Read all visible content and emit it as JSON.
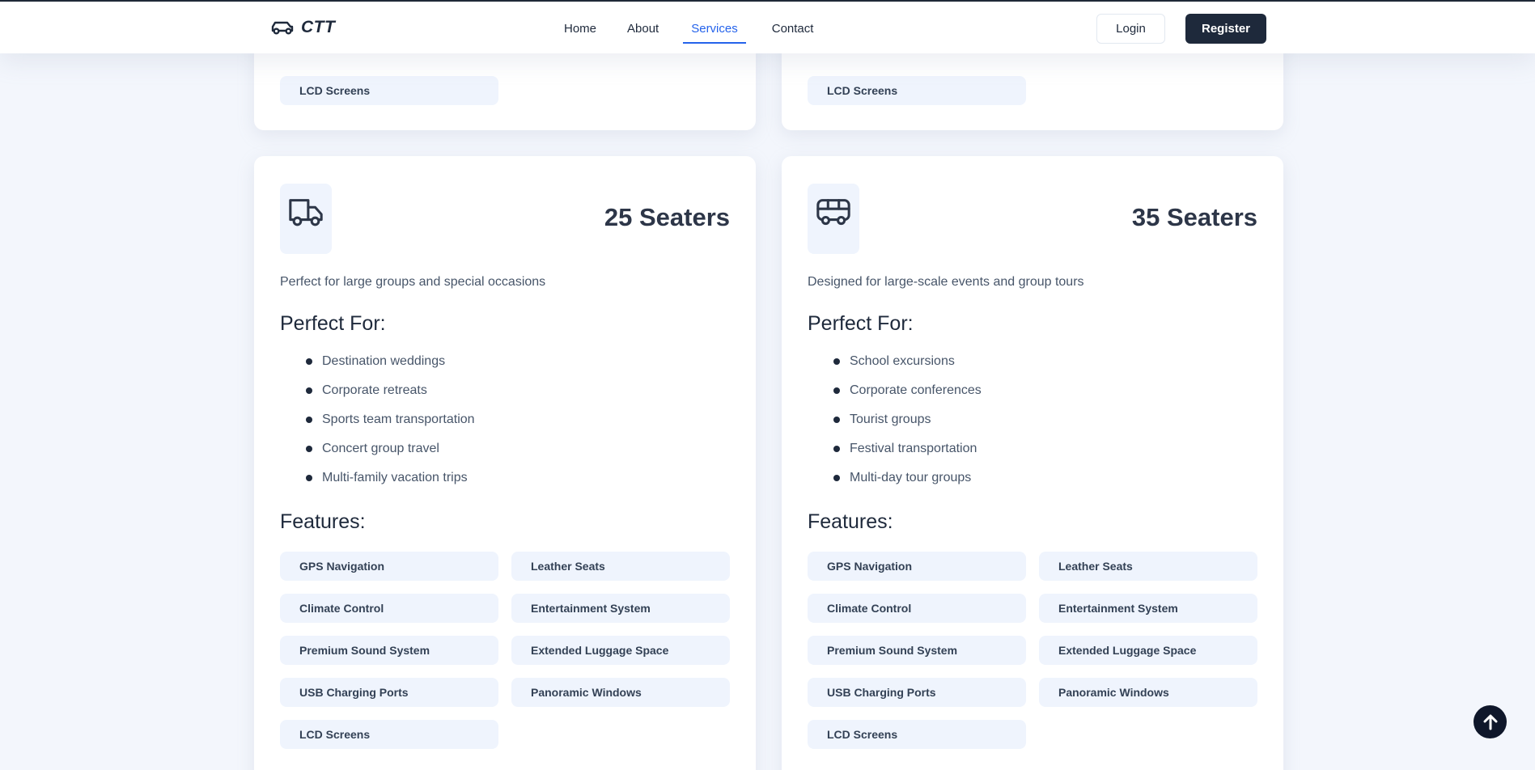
{
  "header": {
    "logo_text": "CTT",
    "nav": [
      {
        "label": "Home"
      },
      {
        "label": "About"
      },
      {
        "label": "Services",
        "active": true
      },
      {
        "label": "Contact"
      }
    ],
    "login_label": "Login",
    "register_label": "Register"
  },
  "top_cards": [
    {
      "last_feature": "LCD Screens"
    },
    {
      "last_feature": "LCD Screens"
    }
  ],
  "cards": [
    {
      "icon": "truck-icon",
      "title": "25 Seaters",
      "description": "Perfect for large groups and special occasions",
      "perfect_for_title": "Perfect For:",
      "perfect_for": [
        "Destination weddings",
        "Corporate retreats",
        "Sports team transportation",
        "Concert group travel",
        "Multi-family vacation trips"
      ],
      "features_title": "Features:",
      "features": [
        "GPS Navigation",
        "Leather Seats",
        "Climate Control",
        "Entertainment System",
        "Premium Sound System",
        "Extended Luggage Space",
        "USB Charging Ports",
        "Panoramic Windows",
        "LCD Screens"
      ]
    },
    {
      "icon": "bus-icon",
      "title": "35 Seaters",
      "description": "Designed for large-scale events and group tours",
      "perfect_for_title": "Perfect For:",
      "perfect_for": [
        "School excursions",
        "Corporate conferences",
        "Tourist groups",
        "Festival transportation",
        "Multi-day tour groups"
      ],
      "features_title": "Features:",
      "features": [
        "GPS Navigation",
        "Leather Seats",
        "Climate Control",
        "Entertainment System",
        "Premium Sound System",
        "Extended Luggage Space",
        "USB Charging Ports",
        "Panoramic Windows",
        "LCD Screens"
      ]
    }
  ],
  "colors": {
    "accent": "#2563eb",
    "dark": "#1e293b",
    "chip_bg": "#eff4fd",
    "page_bg": "#f3f6fc"
  },
  "scroll_top_icon": "arrow-up-icon"
}
